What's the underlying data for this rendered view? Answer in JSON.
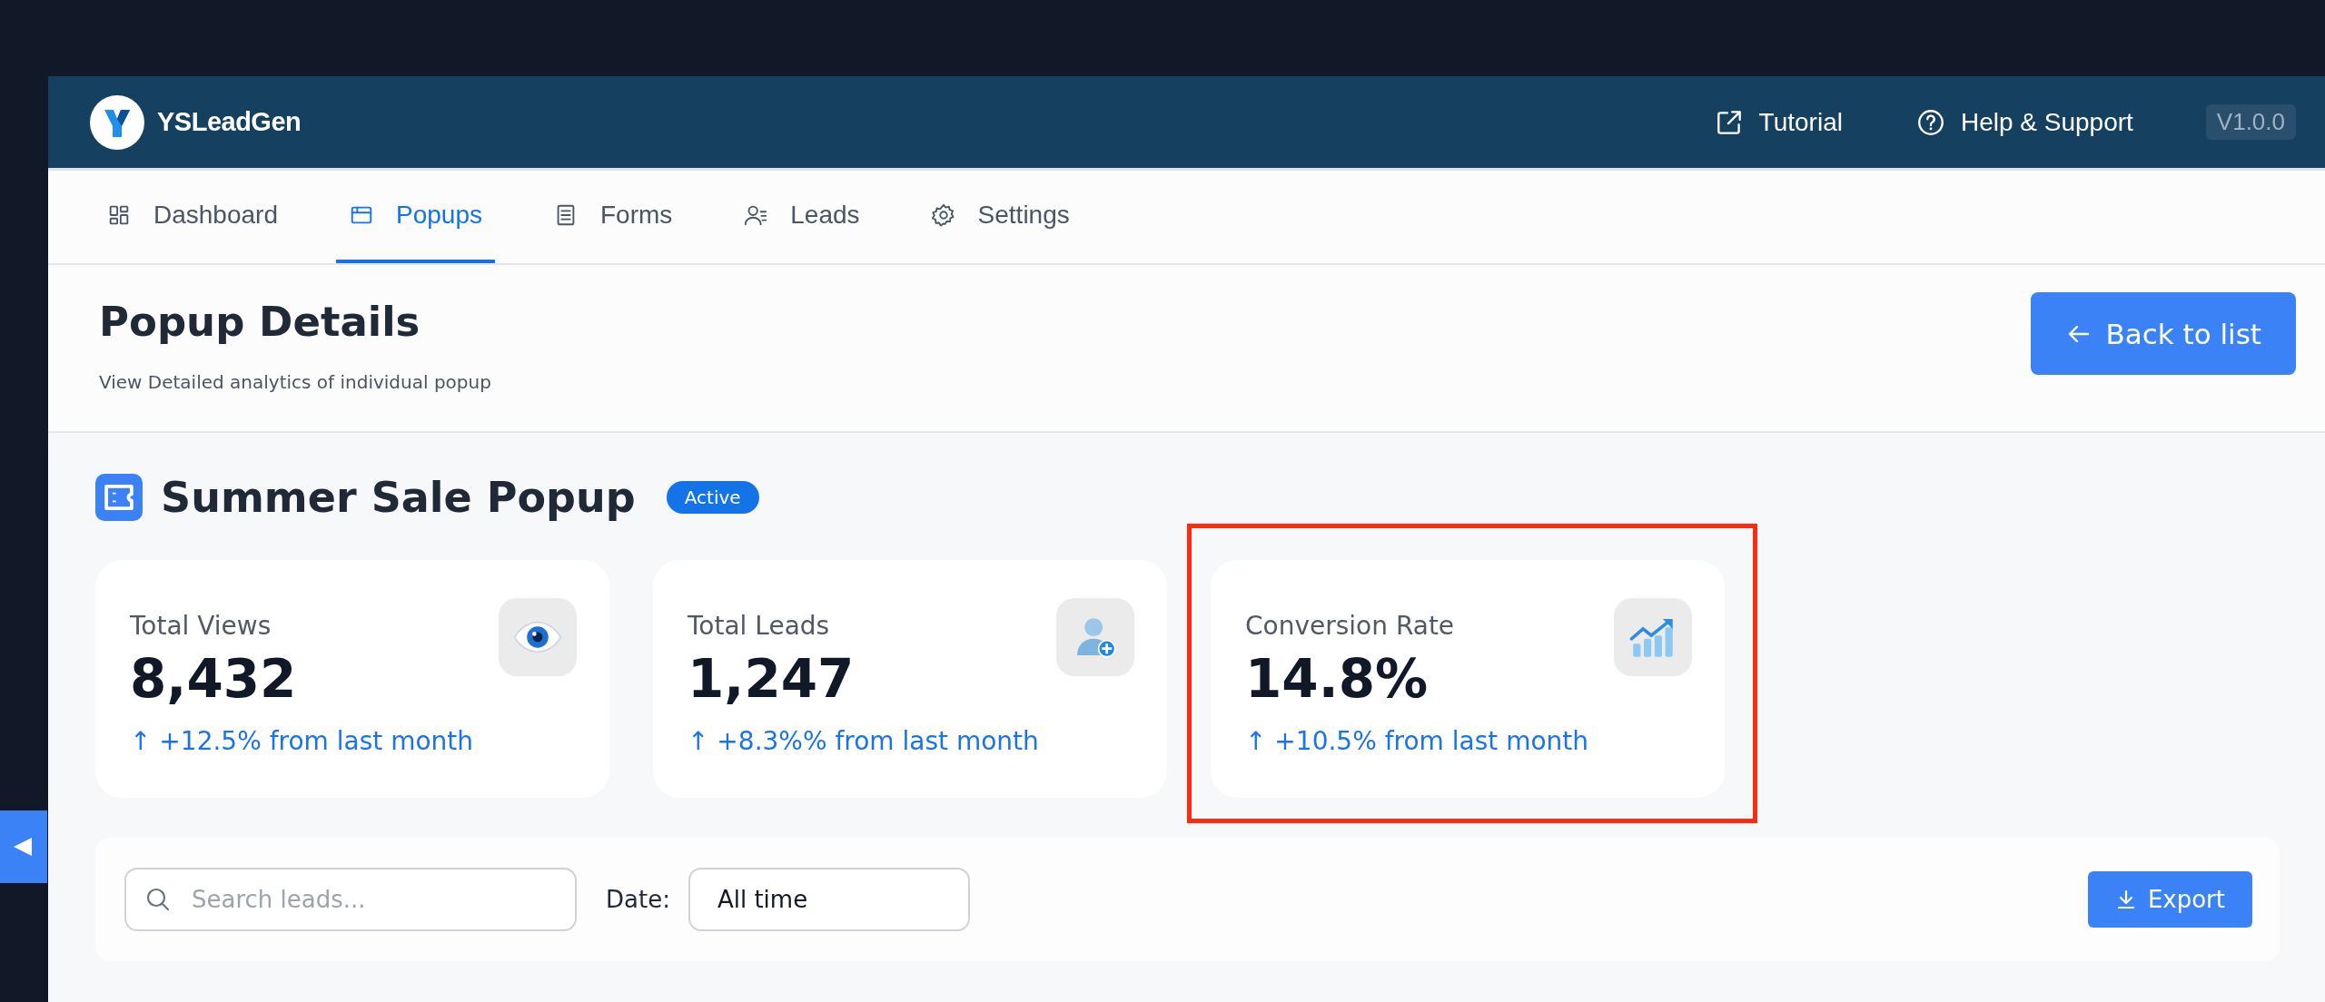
{
  "app": {
    "name": "YSLeadGen",
    "links": [
      {
        "label": "Tutorial"
      },
      {
        "label": "Help & Support"
      }
    ],
    "version": "V1.0.0"
  },
  "tabs": [
    {
      "label": "Dashboard",
      "selected": false
    },
    {
      "label": "Popups",
      "selected": true
    },
    {
      "label": "Forms",
      "selected": false
    },
    {
      "label": "Leads",
      "selected": false
    },
    {
      "label": "Settings",
      "selected": false
    }
  ],
  "page": {
    "title": "Popup Details",
    "subtitle": "View Detailed analytics of individual popup",
    "back_button": "Back to list"
  },
  "popup": {
    "name": "Summer Sale Popup",
    "status": "Active"
  },
  "stats": [
    {
      "label": "Total Views",
      "value": "8,432",
      "trend": "↑ +12.5% from last month",
      "highlighted": false
    },
    {
      "label": "Total Leads",
      "value": "1,247",
      "trend": "↑ +8.3%% from last month",
      "highlighted": false
    },
    {
      "label": "Conversion Rate",
      "value": "14.8%",
      "trend": "↑ +10.5% from last month",
      "highlighted": true
    }
  ],
  "filters": {
    "search_placeholder": "Search leads...",
    "date_label": "Date:",
    "date_value": "All time",
    "export_button": "Export"
  }
}
